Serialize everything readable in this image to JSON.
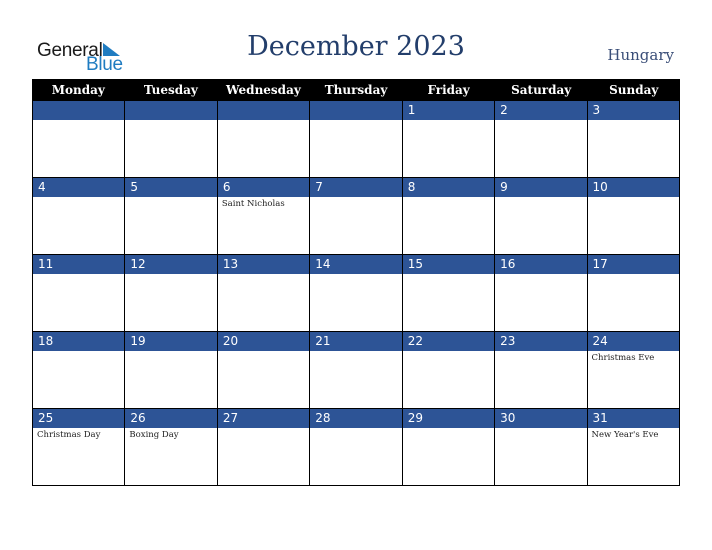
{
  "logo": {
    "line1": "General",
    "line2": "Blue"
  },
  "title": "December 2023",
  "country": "Hungary",
  "colors": {
    "header_bg": "#000000",
    "band_bg": "#2d5496",
    "title": "#233e6b",
    "logo_blue": "#1f7cc1"
  },
  "weekdays": [
    "Monday",
    "Tuesday",
    "Wednesday",
    "Thursday",
    "Friday",
    "Saturday",
    "Sunday"
  ],
  "weeks": [
    [
      {
        "day": "",
        "event": ""
      },
      {
        "day": "",
        "event": ""
      },
      {
        "day": "",
        "event": ""
      },
      {
        "day": "",
        "event": ""
      },
      {
        "day": "1",
        "event": ""
      },
      {
        "day": "2",
        "event": ""
      },
      {
        "day": "3",
        "event": ""
      }
    ],
    [
      {
        "day": "4",
        "event": ""
      },
      {
        "day": "5",
        "event": ""
      },
      {
        "day": "6",
        "event": "Saint Nicholas"
      },
      {
        "day": "7",
        "event": ""
      },
      {
        "day": "8",
        "event": ""
      },
      {
        "day": "9",
        "event": ""
      },
      {
        "day": "10",
        "event": ""
      }
    ],
    [
      {
        "day": "11",
        "event": ""
      },
      {
        "day": "12",
        "event": ""
      },
      {
        "day": "13",
        "event": ""
      },
      {
        "day": "14",
        "event": ""
      },
      {
        "day": "15",
        "event": ""
      },
      {
        "day": "16",
        "event": ""
      },
      {
        "day": "17",
        "event": ""
      }
    ],
    [
      {
        "day": "18",
        "event": ""
      },
      {
        "day": "19",
        "event": ""
      },
      {
        "day": "20",
        "event": ""
      },
      {
        "day": "21",
        "event": ""
      },
      {
        "day": "22",
        "event": ""
      },
      {
        "day": "23",
        "event": ""
      },
      {
        "day": "24",
        "event": "Christmas Eve"
      }
    ],
    [
      {
        "day": "25",
        "event": "Christmas Day"
      },
      {
        "day": "26",
        "event": "Boxing Day"
      },
      {
        "day": "27",
        "event": ""
      },
      {
        "day": "28",
        "event": ""
      },
      {
        "day": "29",
        "event": ""
      },
      {
        "day": "30",
        "event": ""
      },
      {
        "day": "31",
        "event": "New Year's Eve"
      }
    ]
  ]
}
